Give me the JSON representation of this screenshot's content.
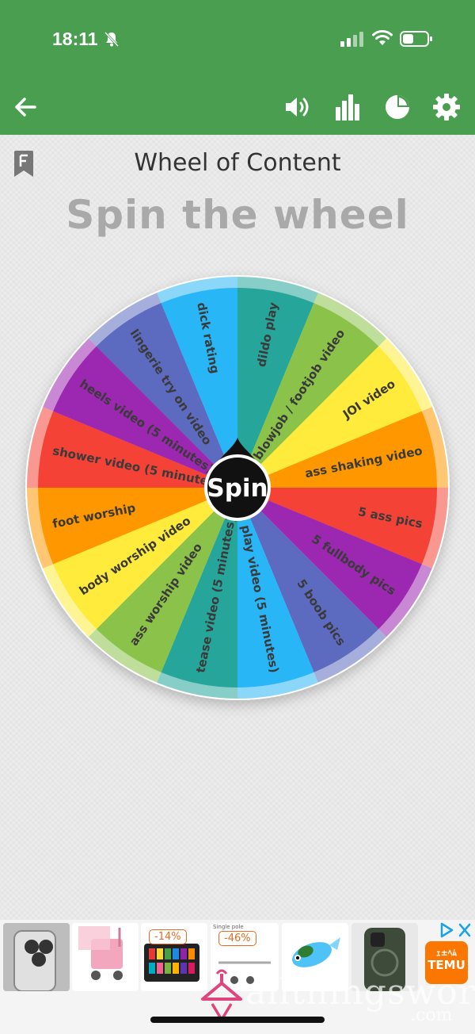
{
  "status": {
    "time": "18:11"
  },
  "header": {
    "title": "Wheel of Content",
    "subtitle": "Spin the wheel"
  },
  "wheel": {
    "spin_label": "Spin",
    "segments": [
      {
        "label": "dildo play",
        "color": "#26a69a"
      },
      {
        "label": "blowjob / footjob video",
        "color": "#8bc34a"
      },
      {
        "label": "JOI video",
        "color": "#ffeb3b"
      },
      {
        "label": "ass shaking video",
        "color": "#ff9800"
      },
      {
        "label": "5 ass pics",
        "color": "#f44336"
      },
      {
        "label": "5 fullbody pics",
        "color": "#9c27b0"
      },
      {
        "label": "5 boob pics",
        "color": "#5c6bc0"
      },
      {
        "label": "solo play video (5 minutes)",
        "color": "#29b6f6"
      },
      {
        "label": "tease video (5 minutes)",
        "color": "#26a69a"
      },
      {
        "label": "ass worship video",
        "color": "#8bc34a"
      },
      {
        "label": "body worship video",
        "color": "#ffeb3b"
      },
      {
        "label": "foot worship",
        "color": "#ff9800"
      },
      {
        "label": "shower video (5 minutes)",
        "color": "#f44336"
      },
      {
        "label": "heels video (5 minutes)",
        "color": "#9c27b0"
      },
      {
        "label": "lingerie try on video",
        "color": "#5c6bc0"
      },
      {
        "label": "dick rating",
        "color": "#29b6f6"
      }
    ]
  },
  "ads": {
    "discount_1": "-14%",
    "discount_2": "-46%",
    "ad_caption": "Single pole",
    "temu_label_top": "ｪ±ﾍﾑ",
    "temu_label": "TEMU"
  },
  "watermark": {
    "text": "allthingsworn",
    "suffix": ".com"
  }
}
